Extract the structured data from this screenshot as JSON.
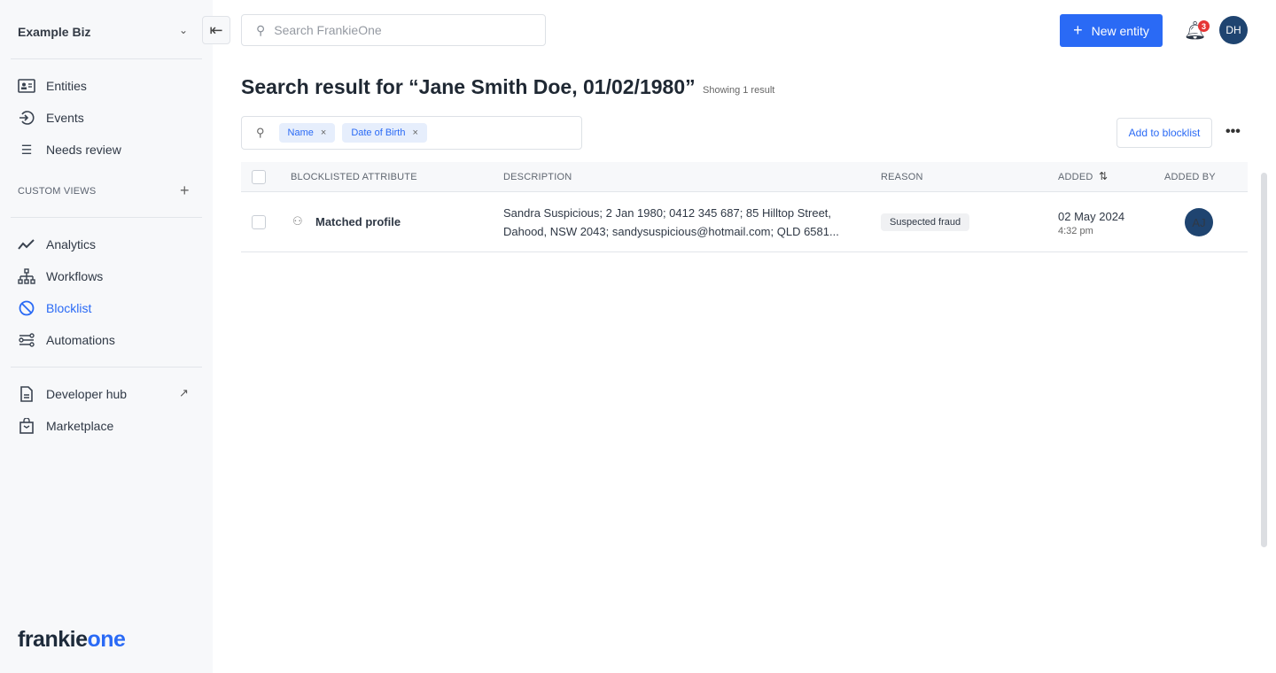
{
  "sidebar": {
    "org": "Example Biz",
    "custom_views": "CUSTOM VIEWS",
    "items": [
      {
        "label": "Entities"
      },
      {
        "label": "Events"
      },
      {
        "label": "Needs review"
      },
      {
        "label": "Analytics"
      },
      {
        "label": "Workflows"
      },
      {
        "label": "Blocklist"
      },
      {
        "label": "Automations"
      },
      {
        "label": "Developer hub"
      },
      {
        "label": "Marketplace"
      }
    ],
    "logo": {
      "a": "frankie",
      "b": "one"
    }
  },
  "header": {
    "search_placeholder": "Search FrankieOne",
    "new_entity": "New entity",
    "notif_count": "3",
    "user_initials": "DH"
  },
  "page": {
    "title": "Search result for “Jane Smith Doe, 01/02/1980”",
    "showing": "Showing 1 result",
    "filters": [
      "Name",
      "Date of Birth"
    ],
    "add_to_blocklist": "Add to blocklist"
  },
  "table": {
    "columns": [
      "BLOCKLISTED ATTRIBUTE",
      "DESCRIPTION",
      "REASON",
      "ADDED",
      "ADDED BY"
    ],
    "rows": [
      {
        "attribute": "Matched profile",
        "desc1": "Sandra Suspicious; 2 Jan 1980; 0412 345 687; 85 Hilltop Street,",
        "desc2": "Dahood, NSW 2043; sandysuspicious@hotmail.com; QLD 6581...",
        "reason": "Suspected fraud",
        "date": "02 May 2024",
        "time": "4:32 pm",
        "added_by": "AJ"
      }
    ]
  },
  "colors": {
    "accent": "#2a6af5",
    "avatar": "#1f4470"
  }
}
